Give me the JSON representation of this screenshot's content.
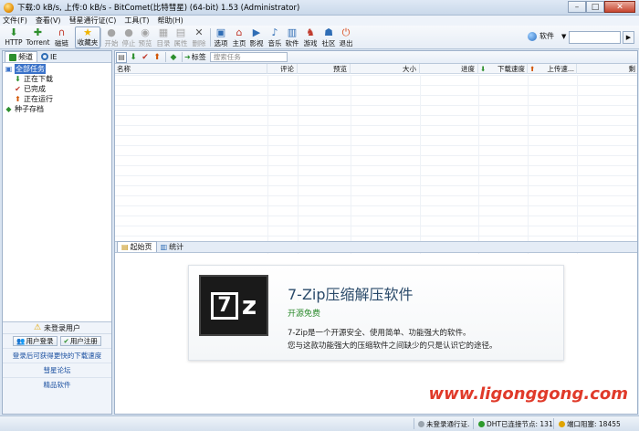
{
  "window": {
    "title": "下载:0 kB/s, 上传:0 kB/s - BitComet(比特彗星) (64-bit) 1.53 (Administrator)",
    "buttons": [
      "–",
      "□",
      "✕"
    ]
  },
  "menu": [
    "文件(F)",
    "查看(V)",
    "彗星通行证(C)",
    "工具(T)",
    "帮助(H)"
  ],
  "toolbar": {
    "items": [
      {
        "label": "HTTP",
        "icon": "http-icon",
        "glyph": "⬇",
        "color": "#2d8f2d",
        "enabled": true
      },
      {
        "label": "Torrent",
        "icon": "torrent-icon",
        "glyph": "✚",
        "color": "#2d8f2d",
        "enabled": true
      },
      {
        "label": "磁链",
        "icon": "magnet-icon",
        "glyph": "∩",
        "color": "#c0392b",
        "enabled": true
      },
      {
        "label": "收藏夹",
        "icon": "favorites-icon",
        "glyph": "★",
        "color": "#f0b400",
        "enabled": true,
        "active": true
      },
      {
        "label": "开始",
        "icon": "start-icon",
        "glyph": "●",
        "color": "#a5a5a5",
        "enabled": false
      },
      {
        "label": "停止",
        "icon": "stop-icon",
        "glyph": "●",
        "color": "#a5a5a5",
        "enabled": false
      },
      {
        "label": "预览",
        "icon": "preview-icon",
        "glyph": "◉",
        "color": "#a5a5a5",
        "enabled": false
      },
      {
        "label": "目录",
        "icon": "folder-icon",
        "glyph": "▦",
        "color": "#a5a5a5",
        "enabled": false
      },
      {
        "label": "属性",
        "icon": "properties-icon",
        "glyph": "▤",
        "color": "#a5a5a5",
        "enabled": false
      },
      {
        "label": "删除",
        "icon": "delete-icon",
        "glyph": "✕",
        "color": "#555",
        "enabled": false
      },
      {
        "label": "选项",
        "icon": "options-icon",
        "glyph": "▣",
        "color": "#2f6db5",
        "enabled": true
      },
      {
        "label": "主页",
        "icon": "home-icon",
        "glyph": "⌂",
        "color": "#c0392b",
        "enabled": true
      },
      {
        "label": "影视",
        "icon": "video-icon",
        "glyph": "▶",
        "color": "#2f6db5",
        "enabled": true
      },
      {
        "label": "音乐",
        "icon": "music-icon",
        "glyph": "♪",
        "color": "#2f6db5",
        "enabled": true
      },
      {
        "label": "软件",
        "icon": "software-icon",
        "glyph": "▥",
        "color": "#2f6db5",
        "enabled": true
      },
      {
        "label": "游戏",
        "icon": "game-icon",
        "glyph": "♞",
        "color": "#c0392b",
        "enabled": true
      },
      {
        "label": "社区",
        "icon": "community-icon",
        "glyph": "☗",
        "color": "#2f6db5",
        "enabled": true
      },
      {
        "label": "退出",
        "icon": "exit-icon",
        "glyph": "⏻",
        "color": "#d94a1a",
        "enabled": true
      }
    ],
    "search_category": "软件",
    "search_value": "",
    "search_button": "▶"
  },
  "sidebar": {
    "tabs": [
      {
        "label": "频道",
        "active": true
      },
      {
        "label": "IE",
        "active": false
      }
    ],
    "tree": [
      {
        "label": "全部任务",
        "indent": 0,
        "icon_glyph": "▣",
        "icon_color": "#3a72c9",
        "selected": true
      },
      {
        "label": "正在下载",
        "indent": 1,
        "icon_glyph": "⬇",
        "icon_color": "#2d8f2d",
        "selected": false
      },
      {
        "label": "已完成",
        "indent": 1,
        "icon_glyph": "✔",
        "icon_color": "#c0392b",
        "selected": false
      },
      {
        "label": "正在运行",
        "indent": 1,
        "icon_glyph": "⬆",
        "icon_color": "#d35400",
        "selected": false
      },
      {
        "label": "种子存档",
        "indent": 0,
        "icon_glyph": "◆",
        "icon_color": "#2d8f2d",
        "selected": false
      }
    ],
    "account": {
      "warning": "未登录用户",
      "login": "用户登录",
      "register": "用户注册",
      "links": [
        "登录后可获得更快的下载速度",
        "彗星论坛",
        "精品软件"
      ]
    }
  },
  "tasklist": {
    "subtoolbar_tag": "标签",
    "search_placeholder": "搜索任务",
    "columns": [
      "名称",
      "评论",
      "预览",
      "大小",
      "进度",
      "下载速度",
      "上传速...",
      "剩"
    ]
  },
  "detail": {
    "tabs": [
      "起始页",
      "统计"
    ],
    "ad": {
      "title": "7-Zip压缩解压软件",
      "subtitle": "开源免费",
      "desc1": "7-Zip是一个开源安全、使用简单、功能强大的软件。",
      "desc2": "您与这款功能强大的压缩软件之间缺少的只是认识它的途径。"
    },
    "watermark": "www.ligonggong.com"
  },
  "status": {
    "login": "未登录通行证.",
    "dht": "DHT已连接节点: 131",
    "port": "端口阻塞: 18455"
  }
}
